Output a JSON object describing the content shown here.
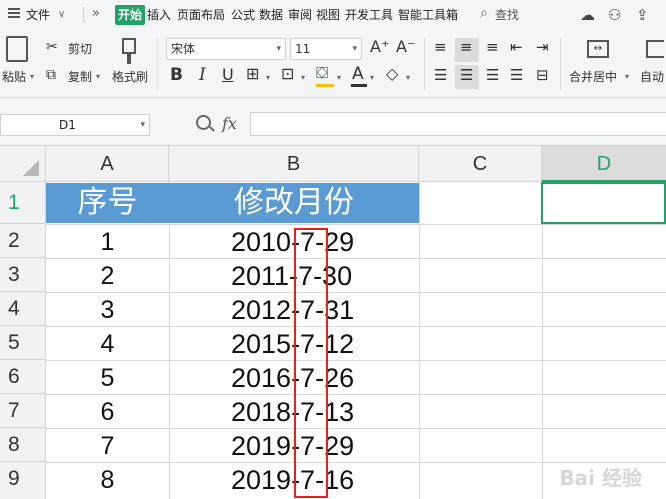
{
  "menubar": {
    "file_label": "文件",
    "tabs": [
      "开始",
      "插入",
      "页面布局",
      "公式",
      "数据",
      "审阅",
      "视图",
      "开发工具",
      "智能工具箱"
    ],
    "search_label": "查找"
  },
  "ribbon": {
    "cut": "剪切",
    "copy": "复制",
    "paste": "粘贴",
    "format_painter": "格式刷",
    "font_name": "宋体",
    "font_size": "11",
    "merge_center": "合并居中",
    "auto_wrap": "自动"
  },
  "formula_bar": {
    "cell_ref": "D1",
    "fx_label": "fx",
    "formula": ""
  },
  "sheet": {
    "columns": [
      "A",
      "B",
      "C",
      "D"
    ],
    "rows": [
      "1",
      "2",
      "3",
      "4",
      "5",
      "6",
      "7",
      "8",
      "9"
    ],
    "header": {
      "a": "序号",
      "b": "修改月份"
    },
    "data": [
      {
        "a": "1",
        "b": "2010-7-29"
      },
      {
        "a": "2",
        "b": "2011-7-30"
      },
      {
        "a": "3",
        "b": "2012-7-31"
      },
      {
        "a": "4",
        "b": "2015-7-12"
      },
      {
        "a": "5",
        "b": "2016-7-26"
      },
      {
        "a": "6",
        "b": "2018-7-13"
      },
      {
        "a": "7",
        "b": "2019-7-29"
      },
      {
        "a": "8",
        "b": "2019-7-16"
      }
    ],
    "selected_cell": "D1"
  },
  "colors": {
    "accent": "#21a366",
    "header_fill": "#5b9bd5",
    "highlight_border": "#e2231a"
  },
  "watermark": "Bai 经验"
}
